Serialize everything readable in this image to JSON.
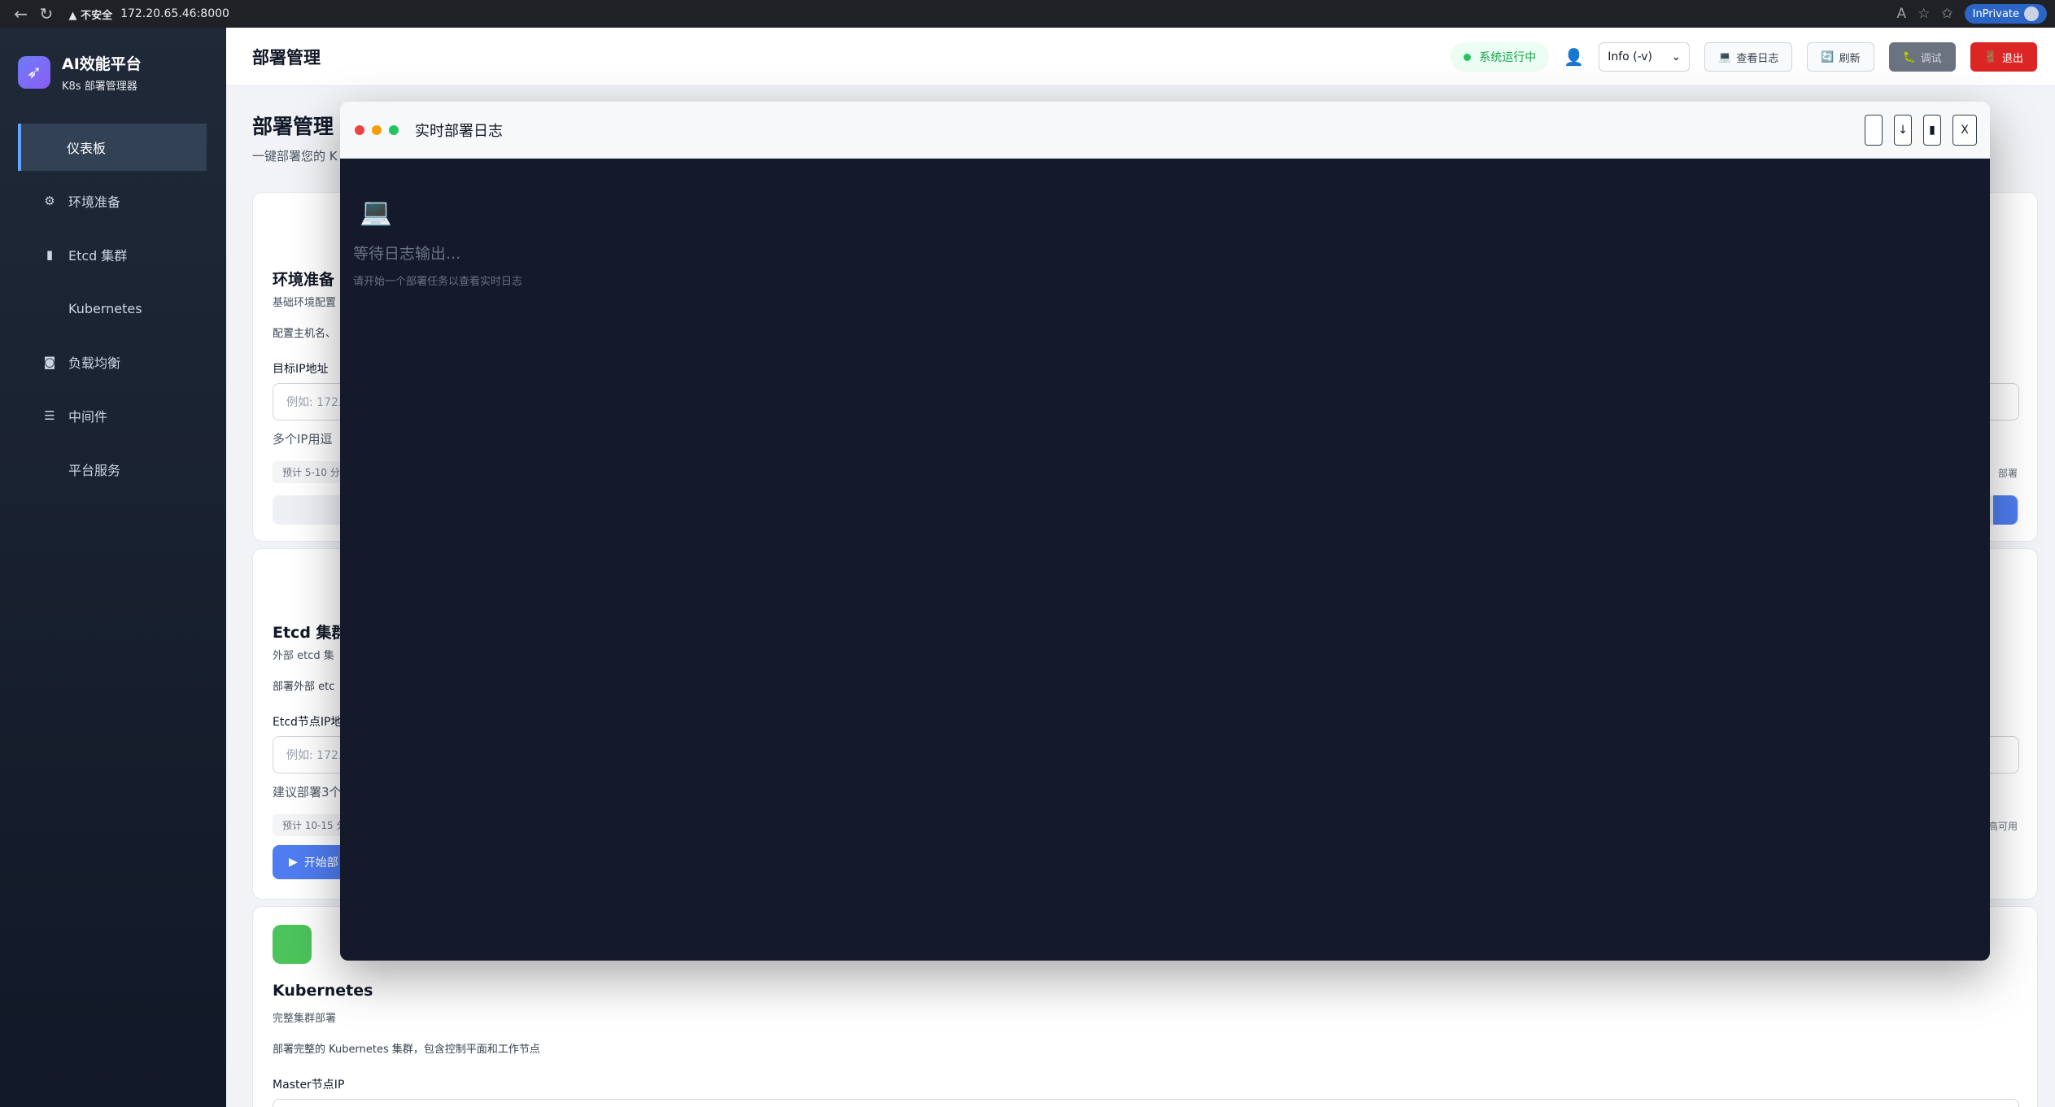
{
  "browser": {
    "insecure_label": "不安全",
    "url": "172.20.65.46:8000",
    "inprivate": "InPrivate"
  },
  "sidebar": {
    "brand_title": "AI效能平台",
    "brand_subtitle": "K8s 部署管理器",
    "items": [
      {
        "label": "仪表板",
        "icon": "none",
        "active": true
      },
      {
        "label": "环境准备",
        "icon": "gear-icon"
      },
      {
        "label": "Etcd 集群",
        "icon": "database-icon"
      },
      {
        "label": "Kubernetes",
        "icon": "none"
      },
      {
        "label": "负载均衡",
        "icon": "binoculars-icon"
      },
      {
        "label": "中间件",
        "icon": "stack-icon"
      },
      {
        "label": "平台服务",
        "icon": "none"
      }
    ]
  },
  "header": {
    "title": "部署管理",
    "status": "系统运行中",
    "log_level": "Info (-v)",
    "view_logs": "查看日志",
    "refresh": "刷新",
    "debug": "调试",
    "logout": "退出"
  },
  "main": {
    "title": "部署管理",
    "subtitle": "一键部署您的 K",
    "cards": {
      "env": {
        "title": "环境准备",
        "subtitle": "基础环境配置",
        "desc": "配置主机名、",
        "ip_label": "目标IP地址",
        "ip_placeholder": "例如: 172.",
        "hint": "多个IP用逗",
        "estimate": "预计 5-10 分",
        "right_note": "部署"
      },
      "etcd": {
        "title": "Etcd 集群",
        "subtitle": "外部 etcd 集",
        "desc": "部署外部 etc",
        "ip_label": "Etcd节点IP地",
        "ip_placeholder": "例如: 172.",
        "hint": "建议部署3个",
        "estimate": "预计 10-15 分",
        "right_note": "高可用",
        "start": "开始部"
      },
      "k8s": {
        "title": "Kubernetes",
        "subtitle": "完整集群部署",
        "desc": "部署完整的 Kubernetes 集群，包含控制平面和工作节点",
        "ip_label": "Master节点IP"
      }
    }
  },
  "log_modal": {
    "title": "实时部署日志",
    "waiting": "等待日志输出...",
    "waiting_sub": "请开始一个部署任务以查看实时日志",
    "close": "X"
  }
}
